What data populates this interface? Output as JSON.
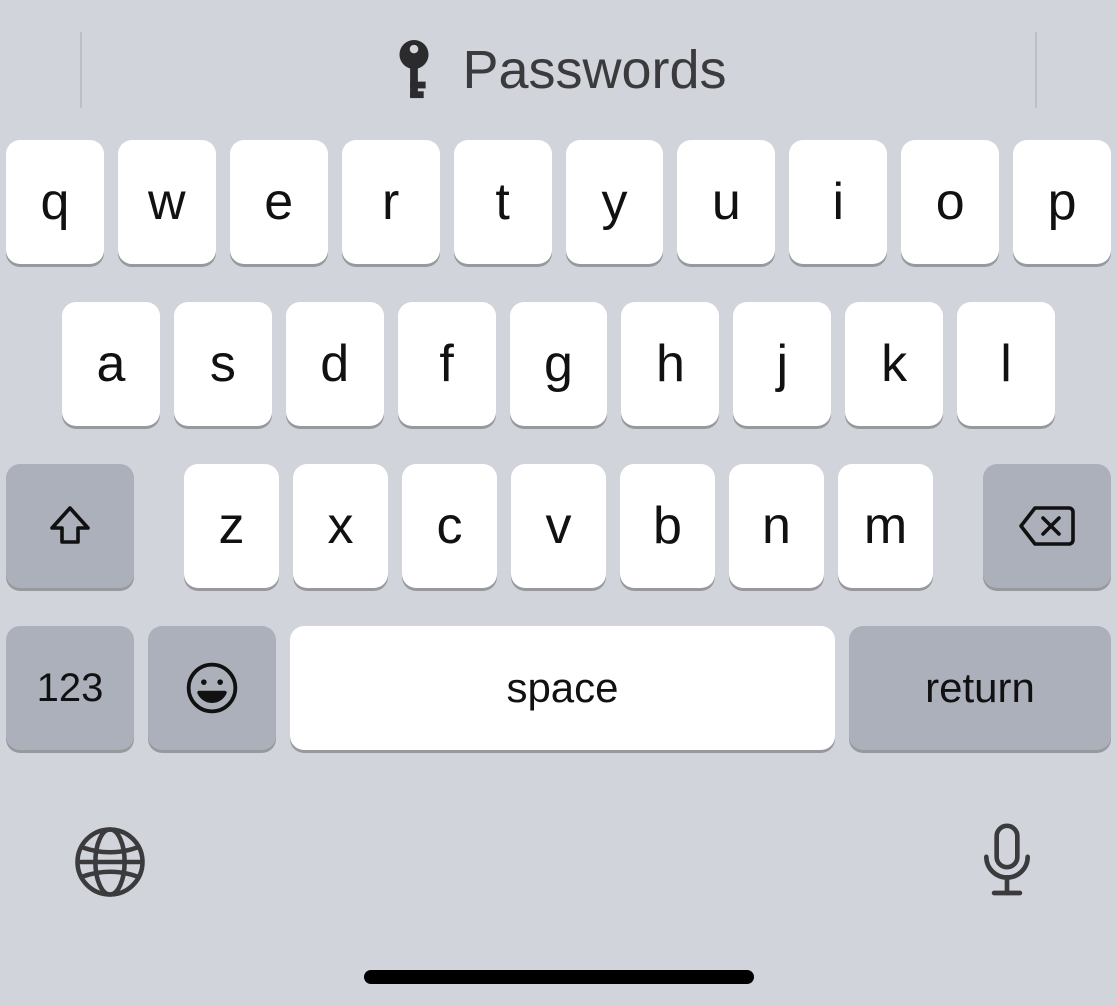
{
  "suggestion": {
    "label": "Passwords"
  },
  "rows": {
    "r1": [
      "q",
      "w",
      "e",
      "r",
      "t",
      "y",
      "u",
      "i",
      "o",
      "p"
    ],
    "r2": [
      "a",
      "s",
      "d",
      "f",
      "g",
      "h",
      "j",
      "k",
      "l"
    ],
    "r3": [
      "z",
      "x",
      "c",
      "v",
      "b",
      "n",
      "m"
    ]
  },
  "keys": {
    "numbers": "123",
    "space": "space",
    "return": "return"
  }
}
